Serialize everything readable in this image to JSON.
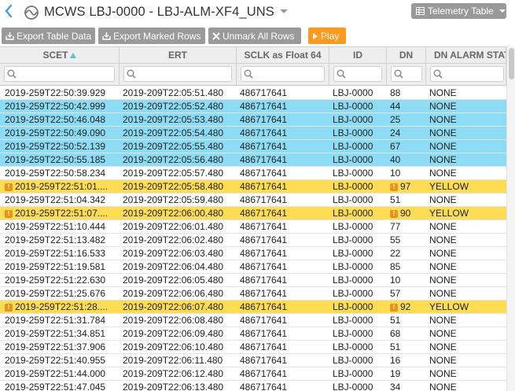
{
  "header": {
    "title": "MCWS LBJ-0000 - LBJ-ALM-XF4_UNS",
    "view_label": "Telemetry Table",
    "icons": [
      "back-chevron-icon",
      "mcws-wave-icon",
      "table-icon",
      "chevron-down-icon"
    ]
  },
  "toolbar": {
    "export_table": "Export Table Data",
    "export_marked": "Export Marked Rows",
    "unmark_all": "Unmark All Rows",
    "play": "Play"
  },
  "colors": {
    "marked_row": "#8ddcf6",
    "alarm_yellow_row": "#fedd55",
    "play_button": "#ff9a1f",
    "sort_indicator": "#4fc3e6"
  },
  "table": {
    "columns": [
      "SCET",
      "ERT",
      "SCLK as Float 64",
      "ID",
      "DN",
      "DN ALARM STATE"
    ],
    "sorted_column": "SCET",
    "sort_direction": "ascending",
    "filter_placeholders": [
      "",
      "",
      "",
      "",
      "",
      ""
    ],
    "rows": [
      {
        "scet": "2019-259T22:50:39.929",
        "ert": "2019-209T22:05:51.480",
        "sclk": "486717641",
        "id": "LBJ-0000",
        "dn": "88",
        "alarm": "NONE",
        "state": "normal"
      },
      {
        "scet": "2019-259T22:50:42.999",
        "ert": "2019-209T22:05:52.480",
        "sclk": "486717641",
        "id": "LBJ-0000",
        "dn": "44",
        "alarm": "NONE",
        "state": "marked"
      },
      {
        "scet": "2019-259T22:50:46.048",
        "ert": "2019-209T22:05:53.480",
        "sclk": "486717641",
        "id": "LBJ-0000",
        "dn": "25",
        "alarm": "NONE",
        "state": "marked"
      },
      {
        "scet": "2019-259T22:50:49.090",
        "ert": "2019-209T22:05:54.480",
        "sclk": "486717641",
        "id": "LBJ-0000",
        "dn": "24",
        "alarm": "NONE",
        "state": "marked"
      },
      {
        "scet": "2019-259T22:50:52.139",
        "ert": "2019-209T22:05:55.480",
        "sclk": "486717641",
        "id": "LBJ-0000",
        "dn": "67",
        "alarm": "NONE",
        "state": "marked"
      },
      {
        "scet": "2019-259T22:50:55.185",
        "ert": "2019-209T22:05:56.480",
        "sclk": "486717641",
        "id": "LBJ-0000",
        "dn": "40",
        "alarm": "NONE",
        "state": "marked"
      },
      {
        "scet": "2019-259T22:50:58.234",
        "ert": "2019-209T22:05:57.480",
        "sclk": "486717641",
        "id": "LBJ-0000",
        "dn": "10",
        "alarm": "NONE",
        "state": "normal"
      },
      {
        "scet": "2019-259T22:51:01....",
        "ert": "2019-209T22:05:58.480",
        "sclk": "486717641",
        "id": "LBJ-0000",
        "dn": "97",
        "alarm": "YELLOW",
        "state": "yellow"
      },
      {
        "scet": "2019-259T22:51:04.342",
        "ert": "2019-209T22:05:59.480",
        "sclk": "486717641",
        "id": "LBJ-0000",
        "dn": "51",
        "alarm": "NONE",
        "state": "normal"
      },
      {
        "scet": "2019-259T22:51:07....",
        "ert": "2019-209T22:06:00.480",
        "sclk": "486717641",
        "id": "LBJ-0000",
        "dn": "90",
        "alarm": "YELLOW",
        "state": "yellow"
      },
      {
        "scet": "2019-259T22:51:10.444",
        "ert": "2019-209T22:06:01.480",
        "sclk": "486717641",
        "id": "LBJ-0000",
        "dn": "77",
        "alarm": "NONE",
        "state": "normal"
      },
      {
        "scet": "2019-259T22:51:13.482",
        "ert": "2019-209T22:06:02.480",
        "sclk": "486717641",
        "id": "LBJ-0000",
        "dn": "55",
        "alarm": "NONE",
        "state": "normal"
      },
      {
        "scet": "2019-259T22:51:16.533",
        "ert": "2019-209T22:06:03.480",
        "sclk": "486717641",
        "id": "LBJ-0000",
        "dn": "22",
        "alarm": "NONE",
        "state": "normal"
      },
      {
        "scet": "2019-259T22:51:19.581",
        "ert": "2019-209T22:06:04.480",
        "sclk": "486717641",
        "id": "LBJ-0000",
        "dn": "85",
        "alarm": "NONE",
        "state": "normal"
      },
      {
        "scet": "2019-259T22:51:22.630",
        "ert": "2019-209T22:06:05.480",
        "sclk": "486717641",
        "id": "LBJ-0000",
        "dn": "10",
        "alarm": "NONE",
        "state": "normal"
      },
      {
        "scet": "2019-259T22:51:25.676",
        "ert": "2019-209T22:06:06.480",
        "sclk": "486717641",
        "id": "LBJ-0000",
        "dn": "57",
        "alarm": "NONE",
        "state": "normal"
      },
      {
        "scet": "2019-259T22:51:28....",
        "ert": "2019-209T22:06:07.480",
        "sclk": "486717641",
        "id": "LBJ-0000",
        "dn": "92",
        "alarm": "YELLOW",
        "state": "yellow"
      },
      {
        "scet": "2019-259T22:51:31.784",
        "ert": "2019-209T22:06:08.480",
        "sclk": "486717641",
        "id": "LBJ-0000",
        "dn": "51",
        "alarm": "NONE",
        "state": "normal"
      },
      {
        "scet": "2019-259T22:51:34.851",
        "ert": "2019-209T22:06:09.480",
        "sclk": "486717641",
        "id": "LBJ-0000",
        "dn": "68",
        "alarm": "NONE",
        "state": "normal"
      },
      {
        "scet": "2019-259T22:51:37.906",
        "ert": "2019-209T22:06:10.480",
        "sclk": "486717641",
        "id": "LBJ-0000",
        "dn": "51",
        "alarm": "NONE",
        "state": "normal"
      },
      {
        "scet": "2019-259T22:51:40.955",
        "ert": "2019-209T22:06:11.480",
        "sclk": "486717641",
        "id": "LBJ-0000",
        "dn": "16",
        "alarm": "NONE",
        "state": "normal"
      },
      {
        "scet": "2019-259T22:51:44.000",
        "ert": "2019-209T22:06:12.480",
        "sclk": "486717641",
        "id": "LBJ-0000",
        "dn": "19",
        "alarm": "NONE",
        "state": "normal"
      },
      {
        "scet": "2019-259T22:51:47.045",
        "ert": "2019-209T22:06:13.480",
        "sclk": "486717641",
        "id": "LBJ-0000",
        "dn": "34",
        "alarm": "NONE",
        "state": "normal"
      }
    ]
  }
}
